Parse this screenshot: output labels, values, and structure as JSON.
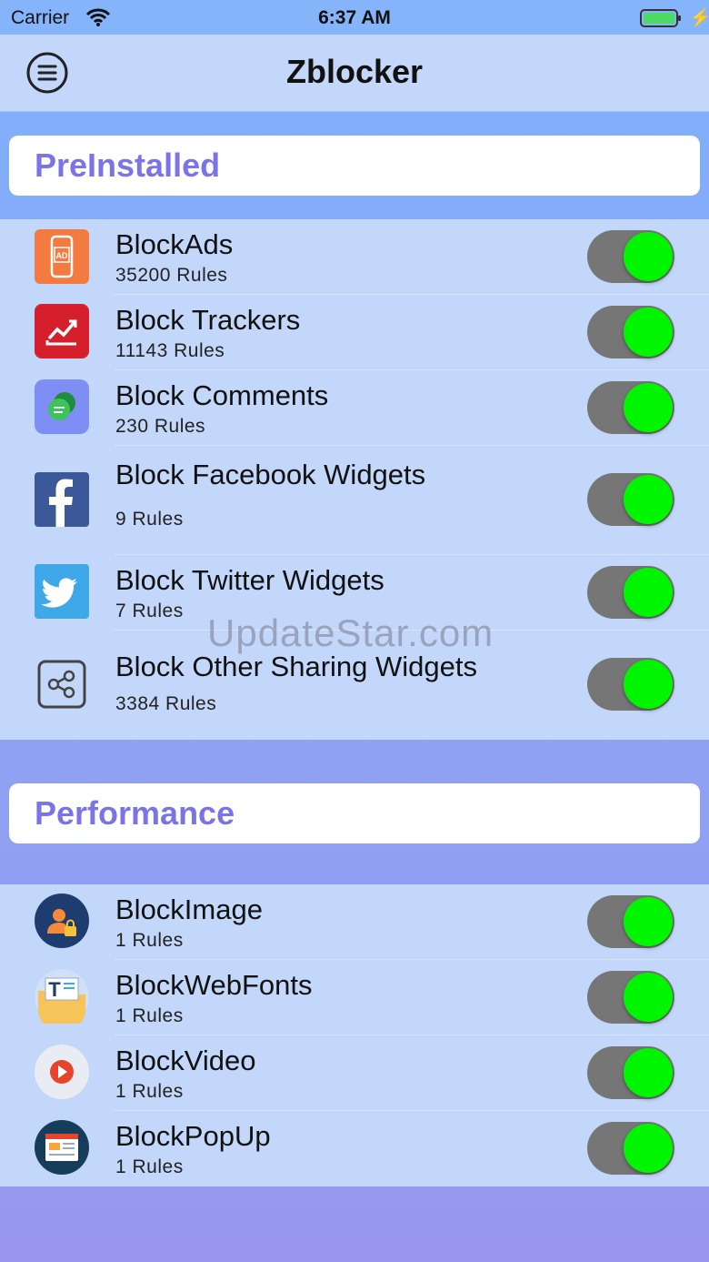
{
  "status": {
    "carrier": "Carrier",
    "time": "6:37 AM"
  },
  "nav": {
    "title": "Zblocker"
  },
  "sections": [
    {
      "title": "PreInstalled"
    },
    {
      "title": "Performance"
    }
  ],
  "preinstalled": [
    {
      "name": "BlockAds",
      "rules": "35200 Rules",
      "enabled": true
    },
    {
      "name": "Block Trackers",
      "rules": "11143 Rules",
      "enabled": true
    },
    {
      "name": "Block Comments",
      "rules": "230 Rules",
      "enabled": true
    },
    {
      "name": "Block Facebook Widgets",
      "rules": "9 Rules",
      "enabled": true
    },
    {
      "name": "Block Twitter Widgets",
      "rules": "7 Rules",
      "enabled": true
    },
    {
      "name": "Block Other Sharing Widgets",
      "rules": "3384 Rules",
      "enabled": true
    }
  ],
  "performance": [
    {
      "name": "BlockImage",
      "rules": "1 Rules",
      "enabled": true
    },
    {
      "name": "BlockWebFonts",
      "rules": "1 Rules",
      "enabled": true
    },
    {
      "name": "BlockVideo",
      "rules": "1 Rules",
      "enabled": true
    },
    {
      "name": "BlockPopUp",
      "rules": "1 Rules",
      "enabled": true
    }
  ],
  "watermark": "UpdateStar.com",
  "colors": {
    "toggle_on": "#00f500",
    "accent": "#7b74e6",
    "list_bg": "#c3d7fa"
  }
}
